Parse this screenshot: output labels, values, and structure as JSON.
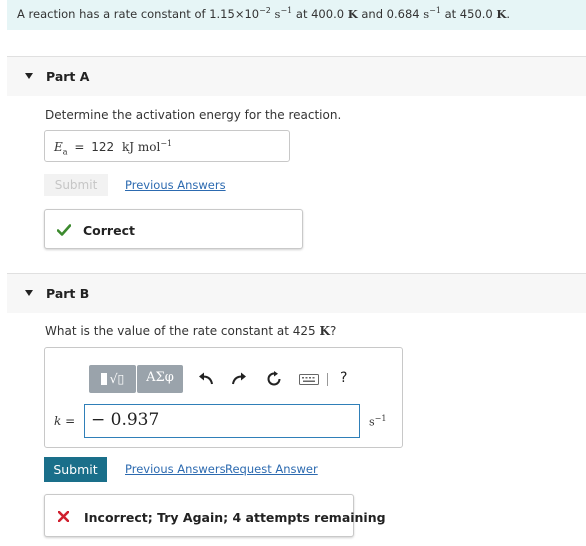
{
  "problem": {
    "lead": "A reaction has a rate constant of 1.15×10",
    "exp1": "−2",
    "unit1": "s",
    "unit1_exp": "−1",
    "mid": "at 400.0",
    "temp_unit1": "K",
    "and_text": "and 0.684",
    "unit2": "s",
    "unit2_exp": "−1",
    "at_text": "at 450.0",
    "temp_unit2": "K",
    "end": "."
  },
  "part_a": {
    "title": "Part A",
    "question": "Determine the activation energy for the reaction.",
    "answer": {
      "symbol": "E",
      "subscript": "a",
      "equals": "=",
      "value": "122",
      "unit": "kJ mol",
      "unit_exp": "−1"
    },
    "submit_label": "Submit",
    "previous_answers_label": "Previous Answers",
    "feedback": "Correct"
  },
  "part_b": {
    "title": "Part B",
    "question_lead": "What is the value of the rate constant at 425",
    "question_unit": "K",
    "question_end": "?",
    "toolbar": {
      "templates_label": "√▯",
      "greek_label": "ΑΣφ",
      "help_label": "?"
    },
    "input": {
      "label": "k =",
      "value": "− 0.937",
      "unit": "s",
      "unit_exp": "−1"
    },
    "submit_label": "Submit",
    "previous_answers_label": "Previous Answers",
    "request_answer_label": "Request Answer",
    "feedback": "Incorrect; Try Again; 4 attempts remaining"
  },
  "colors": {
    "intro_bg": "#e6f5f6",
    "link": "#2c6ab0",
    "submit_bg": "#1a6f8a",
    "correct": "#3c8a2e",
    "incorrect": "#d0202f",
    "toolbar_button": "#9aa3ab",
    "input_border": "#2f7fb8"
  }
}
